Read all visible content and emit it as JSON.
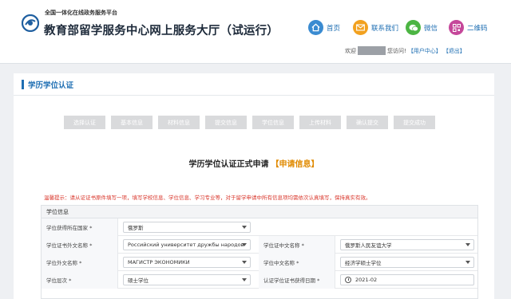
{
  "header": {
    "platform_sub": "全国一体化在线政务服务平台",
    "site_title": "教育部留学服务中心网上服务大厅（试运行）",
    "nav": [
      {
        "label": "首页",
        "icon": "home-icon",
        "color": "#3a8bd1"
      },
      {
        "label": "联系我们",
        "icon": "mail-icon",
        "color": "#f2a11f"
      },
      {
        "label": "微信",
        "icon": "wechat-icon",
        "color": "#4cb543"
      },
      {
        "label": "二维码",
        "icon": "qrcode-icon",
        "color": "#c5479a"
      }
    ],
    "welcome_prefix": "欢迎",
    "welcome_suffix": "您访问!",
    "user_center": "【用户中心】",
    "logout": "【退出】"
  },
  "panel": {
    "title": "学历学位认证",
    "steps": [
      "选择认证",
      "基本信息",
      "材料信息",
      "提交信息",
      "学位信息",
      "上传材料",
      "确认提交",
      "提交成功"
    ],
    "form_title": "学历学位认证正式申请",
    "form_stage": "【申请信息】",
    "notice": "温馨提示：请从证证书原件填写一项，填写学校信息、学位信息、学习专业等，对于留学申请中所有信息项均需依次认真填写，保持真实有效。",
    "section_header": "学位信息",
    "rows": [
      [
        {
          "label": "学位获得所在国家 *",
          "value": "俄罗斯"
        }
      ],
      [
        {
          "label": "学位证书外文名称 *",
          "value": "Российский университет дружбы народов"
        },
        {
          "label": "学位证中文名称 *",
          "value": "俄罗斯人民友谊大学"
        }
      ],
      [
        {
          "label": "学位外文名称 *",
          "value": "МАГИСТР ЭКОНОМИКИ"
        },
        {
          "label": "学位中文名称 *",
          "value": "经济学硕士学位"
        }
      ],
      [
        {
          "label": "学位层次 *",
          "value": "硕士学位"
        },
        {
          "label": "认证学位证书获得日期 *",
          "value": "2021-02"
        }
      ]
    ]
  },
  "colors": {
    "accent": "#1f6fb3",
    "notice": "#d9362b",
    "stage": "#e08a00"
  }
}
